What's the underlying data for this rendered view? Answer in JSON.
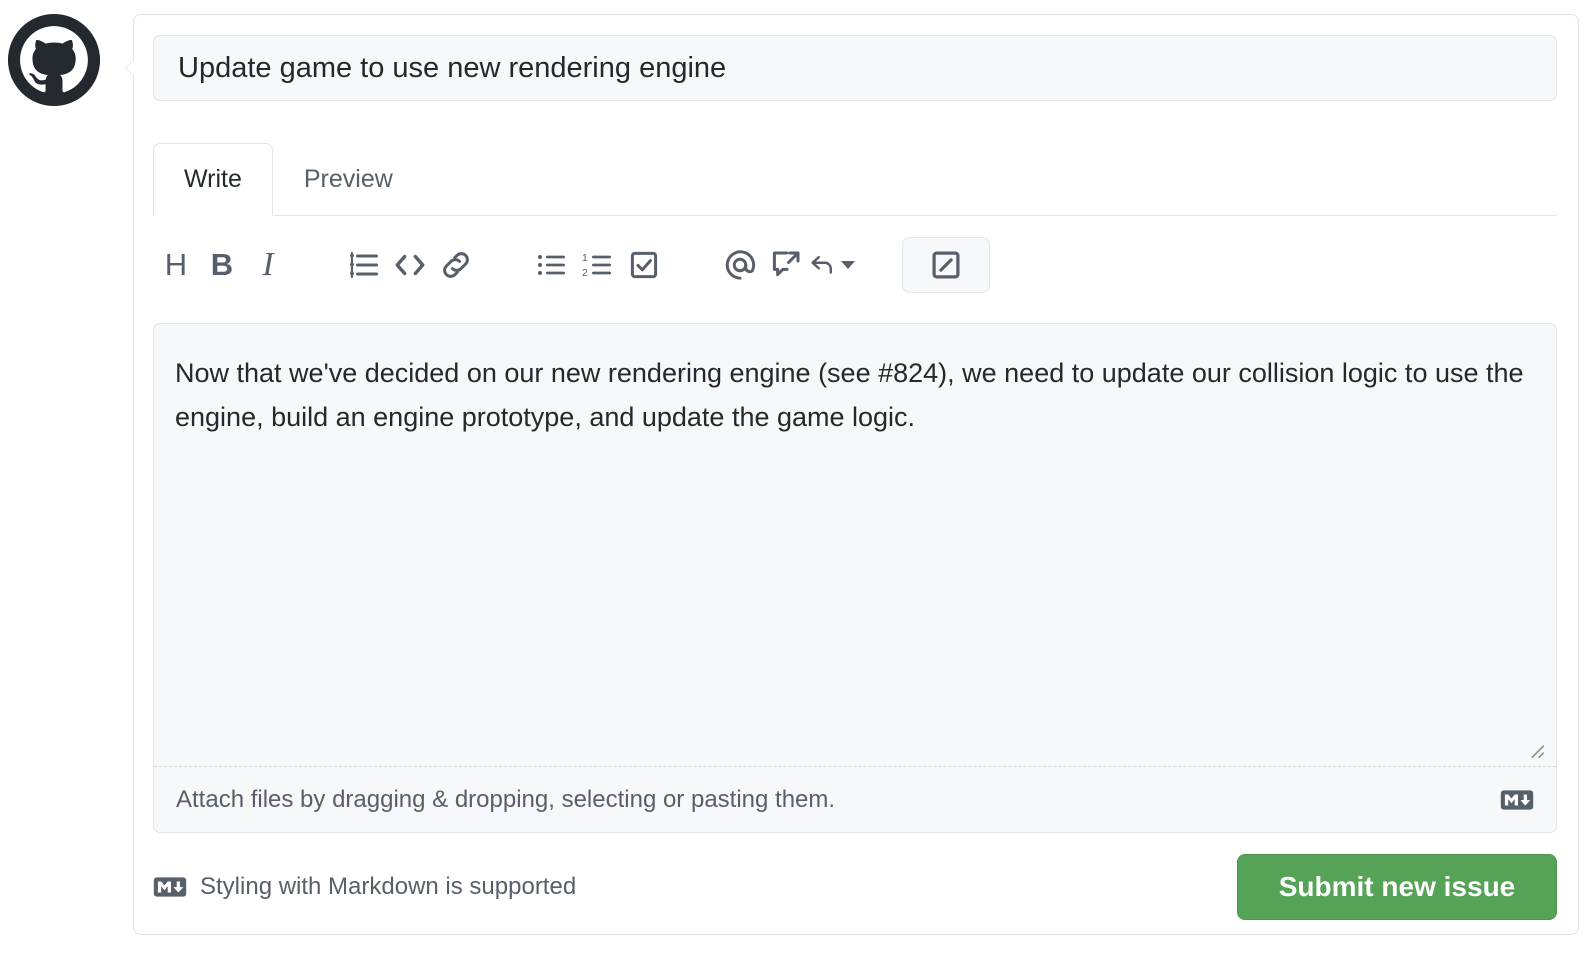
{
  "avatar": {
    "icon": "github-octocat-logo",
    "alt": "GitHub avatar"
  },
  "issue_form": {
    "title_value": "Update game to use new rendering engine",
    "title_placeholder": "Title",
    "body_value": "Now that we've decided on our new rendering engine (see #824), we need to update our collision logic to use the engine, build an engine prototype, and update the game logic.",
    "body_placeholder": "Leave a comment"
  },
  "tabs": [
    {
      "label": "Write",
      "active": true
    },
    {
      "label": "Preview",
      "active": false
    }
  ],
  "toolbar": {
    "buttons": [
      {
        "name": "heading-icon",
        "glyph": "H",
        "type": "text"
      },
      {
        "name": "bold-icon",
        "glyph": "B",
        "type": "text-bold"
      },
      {
        "name": "italic-icon",
        "glyph": "I",
        "type": "text-italic"
      },
      {
        "name": "quote-icon",
        "glyph": "",
        "type": "svg"
      },
      {
        "name": "code-icon",
        "glyph": "<>",
        "type": "svg"
      },
      {
        "name": "link-icon",
        "glyph": "",
        "type": "svg"
      },
      {
        "name": "unordered-list-icon",
        "glyph": "",
        "type": "svg"
      },
      {
        "name": "ordered-list-icon",
        "glyph": "",
        "type": "svg"
      },
      {
        "name": "task-list-icon",
        "glyph": "",
        "type": "svg"
      },
      {
        "name": "mention-icon",
        "glyph": "@",
        "type": "svg"
      },
      {
        "name": "cross-reference-icon",
        "glyph": "",
        "type": "svg"
      },
      {
        "name": "saved-replies-icon",
        "glyph": "",
        "type": "svg"
      },
      {
        "name": "slash-command-icon",
        "glyph": "",
        "type": "svg",
        "selected": true
      }
    ]
  },
  "attach": {
    "text": "Attach files by dragging & dropping, selecting or pasting them.",
    "markdown_icon": "markdown-icon"
  },
  "footer": {
    "markdown_note": "Styling with Markdown is supported",
    "markdown_icon": "markdown-icon",
    "submit_label": "Submit new issue"
  },
  "colors": {
    "submit_green": "#56a256",
    "border": "#e1e4e8",
    "field_bg": "#f6f8fa",
    "text": "#24292f",
    "muted_text": "#57606a"
  }
}
